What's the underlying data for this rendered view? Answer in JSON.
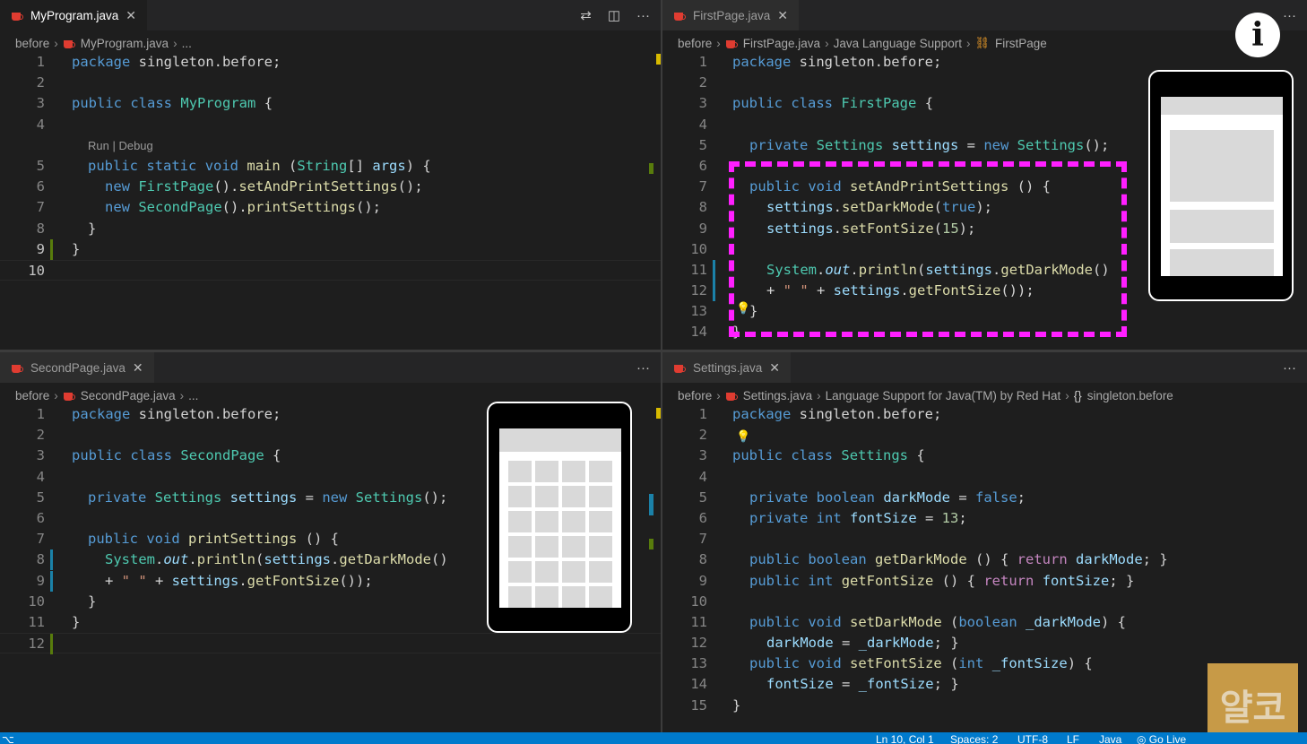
{
  "colors": {
    "accent": "#007acc",
    "highlight": "#ff1fff",
    "editor_bg": "#1e1e1e"
  },
  "panes": {
    "top_left": {
      "tab": {
        "label": "MyProgram.java",
        "close": "✕"
      },
      "breadcrumb": [
        "before",
        "MyProgram.java",
        "..."
      ],
      "codelens": "Run | Debug",
      "lines": [
        "1",
        "2",
        "3",
        "4",
        "5",
        "6",
        "7",
        "8",
        "9",
        "10"
      ]
    },
    "top_right": {
      "tab": {
        "label": "FirstPage.java",
        "close": "✕"
      },
      "breadcrumb": [
        "before",
        "FirstPage.java",
        "Java Language Support",
        "FirstPage"
      ],
      "lines": [
        "1",
        "2",
        "3",
        "4",
        "5",
        "6",
        "7",
        "8",
        "9",
        "10",
        "11",
        "12",
        "13",
        "14"
      ]
    },
    "bottom_left": {
      "tab": {
        "label": "SecondPage.java",
        "close": "✕"
      },
      "breadcrumb": [
        "before",
        "SecondPage.java",
        "..."
      ],
      "lines": [
        "1",
        "2",
        "3",
        "4",
        "5",
        "6",
        "7",
        "8",
        "9",
        "10",
        "11",
        "12"
      ]
    },
    "bottom_right": {
      "tab": {
        "label": "Settings.java",
        "close": "✕"
      },
      "breadcrumb": [
        "before",
        "Settings.java",
        "Language Support for Java(TM) by Red Hat",
        "{}",
        "singleton.before"
      ],
      "lines": [
        "1",
        "2",
        "3",
        "4",
        "5",
        "6",
        "7",
        "8",
        "9",
        "10",
        "11",
        "12",
        "13",
        "14",
        "15"
      ]
    }
  },
  "actions": {
    "compare": "⇄",
    "split": "◫",
    "more": "···"
  },
  "code": {
    "tl": {
      "l1": [
        "package",
        " singleton.before;"
      ],
      "l3": [
        "public",
        " ",
        "class",
        " ",
        "MyProgram",
        " {"
      ],
      "l5": [
        "public",
        " ",
        "static",
        " ",
        "void",
        " ",
        "main",
        " (",
        "String",
        "[] ",
        "args",
        ") {"
      ],
      "l6": [
        "new",
        " ",
        "FirstPage",
        "().",
        "setAndPrintSettings",
        "();"
      ],
      "l7": [
        "new",
        " ",
        "SecondPage",
        "().",
        "printSettings",
        "();"
      ],
      "l8": [
        "}"
      ],
      "l9": [
        "}"
      ]
    },
    "tr": {
      "l1": [
        "package",
        " singleton.before;"
      ],
      "l3": [
        "public",
        " ",
        "class",
        " ",
        "FirstPage",
        " {"
      ],
      "l5": [
        "private",
        " ",
        "Settings",
        " ",
        "settings",
        " = ",
        "new",
        " ",
        "Settings",
        "();"
      ],
      "l7": [
        "public",
        " ",
        "void",
        " ",
        "setAndPrintSettings",
        " () {"
      ],
      "l8": [
        "settings",
        ".",
        "setDarkMode",
        "(",
        "true",
        ");"
      ],
      "l9": [
        "settings",
        ".",
        "setFontSize",
        "(",
        "15",
        ");"
      ],
      "l11": [
        "System",
        ".",
        "out",
        ".",
        "println",
        "(",
        "settings",
        ".",
        "getDarkMode",
        "()"
      ],
      "l12": [
        "+ ",
        "\" \"",
        " + ",
        "settings",
        ".",
        "getFontSize",
        "());"
      ],
      "l13": [
        "}"
      ],
      "l14": [
        "}"
      ]
    },
    "bl": {
      "l1": [
        "package",
        " singleton.before;"
      ],
      "l3": [
        "public",
        " ",
        "class",
        " ",
        "SecondPage",
        " {"
      ],
      "l5": [
        "private",
        " ",
        "Settings",
        " ",
        "settings",
        " = ",
        "new",
        " ",
        "Settings",
        "();"
      ],
      "l7": [
        "public",
        " ",
        "void",
        " ",
        "printSettings",
        " () {"
      ],
      "l8": [
        "System",
        ".",
        "out",
        ".",
        "println",
        "(",
        "settings",
        ".",
        "getDarkMode",
        "()"
      ],
      "l9": [
        "+ ",
        "\" \"",
        " + ",
        "settings",
        ".",
        "getFontSize",
        "());"
      ],
      "l10": [
        "}"
      ],
      "l11": [
        "}"
      ]
    },
    "br": {
      "l1": [
        "package",
        " singleton.before;"
      ],
      "l3": [
        "public",
        " ",
        "class",
        " ",
        "Settings",
        " {"
      ],
      "l5": [
        "private",
        " ",
        "boolean",
        " ",
        "darkMode",
        " = ",
        "false",
        ";"
      ],
      "l6": [
        "private",
        " ",
        "int",
        " ",
        "fontSize",
        " = ",
        "13",
        ";"
      ],
      "l8": [
        "public",
        " ",
        "boolean",
        " ",
        "getDarkMode",
        " () { ",
        "return",
        " ",
        "darkMode",
        "; }"
      ],
      "l9": [
        "public",
        " ",
        "int",
        " ",
        "getFontSize",
        " () { ",
        "return",
        " ",
        "fontSize",
        "; }"
      ],
      "l11": [
        "public",
        " ",
        "void",
        " ",
        "setDarkMode",
        " (",
        "boolean",
        " ",
        "_darkMode",
        ") {"
      ],
      "l12": [
        "darkMode",
        " = ",
        "_darkMode",
        "; }"
      ],
      "l13": [
        "public",
        " ",
        "void",
        " ",
        "setFontSize",
        " (",
        "int",
        " ",
        "_fontSize",
        ") {"
      ],
      "l14": [
        "fontSize",
        " = ",
        "_fontSize",
        "; }"
      ],
      "l15": [
        "}"
      ]
    }
  },
  "overlay": {
    "info": "i",
    "logo": "얄코"
  },
  "statusbar": {
    "left": "⌥",
    "position": "Ln 10, Col 1",
    "spaces": "Spaces: 2",
    "encoding": "UTF-8",
    "eol": "LF",
    "language": "Java",
    "golive": "◎ Go Live"
  }
}
